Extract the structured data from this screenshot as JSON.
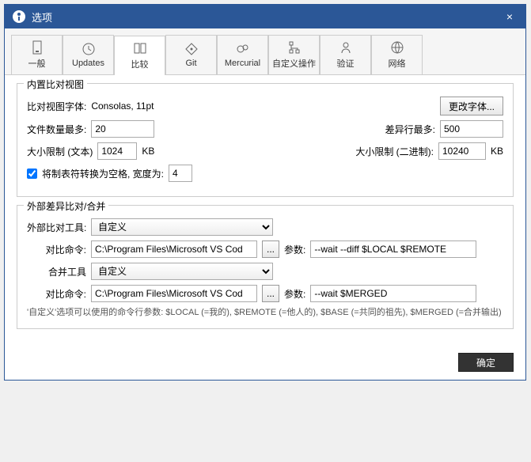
{
  "titlebar": {
    "title": "选项",
    "close": "×"
  },
  "tabs": [
    {
      "label": "一般"
    },
    {
      "label": "Updates"
    },
    {
      "label": "比较"
    },
    {
      "label": "Git"
    },
    {
      "label": "Mercurial"
    },
    {
      "label": "自定义操作"
    },
    {
      "label": "验证"
    },
    {
      "label": "网络"
    }
  ],
  "group1": {
    "title": "内置比对视图",
    "font_label": "比对视图字体:",
    "font_value": "Consolas, 11pt",
    "change_font_btn": "更改字体...",
    "max_files_label": "文件数量最多:",
    "max_files_value": "20",
    "max_diff_lines_label": "差异行最多:",
    "max_diff_lines_value": "500",
    "size_text_label": "大小限制 (文本)",
    "size_text_value": "1024",
    "size_text_unit": "KB",
    "size_bin_label": "大小限制 (二进制):",
    "size_bin_value": "10240",
    "size_bin_unit": "KB",
    "tabs_to_spaces_label": "将制表符转换为空格, 宽度为:",
    "tabs_width_value": "4"
  },
  "group2": {
    "title": "外部差异比对/合并",
    "diff_tool_label": "外部比对工具:",
    "diff_tool_value": "自定义",
    "diff_cmd_label": "对比命令:",
    "diff_cmd_value": "C:\\Program Files\\Microsoft VS Cod",
    "diff_args_label": "参数:",
    "diff_args_value": "--wait --diff $LOCAL $REMOTE",
    "browse": "...",
    "merge_tool_label": "合并工具",
    "merge_tool_value": "自定义",
    "merge_cmd_label": "对比命令:",
    "merge_cmd_value": "C:\\Program Files\\Microsoft VS Cod",
    "merge_args_label": "参数:",
    "merge_args_value": "--wait $MERGED",
    "hint": "'自定义'选项可以使用的命令行参数: $LOCAL (=我的), $REMOTE (=他人的), $BASE (=共同的祖先), $MERGED (=合并输出)"
  },
  "footer": {
    "ok": "确定"
  }
}
